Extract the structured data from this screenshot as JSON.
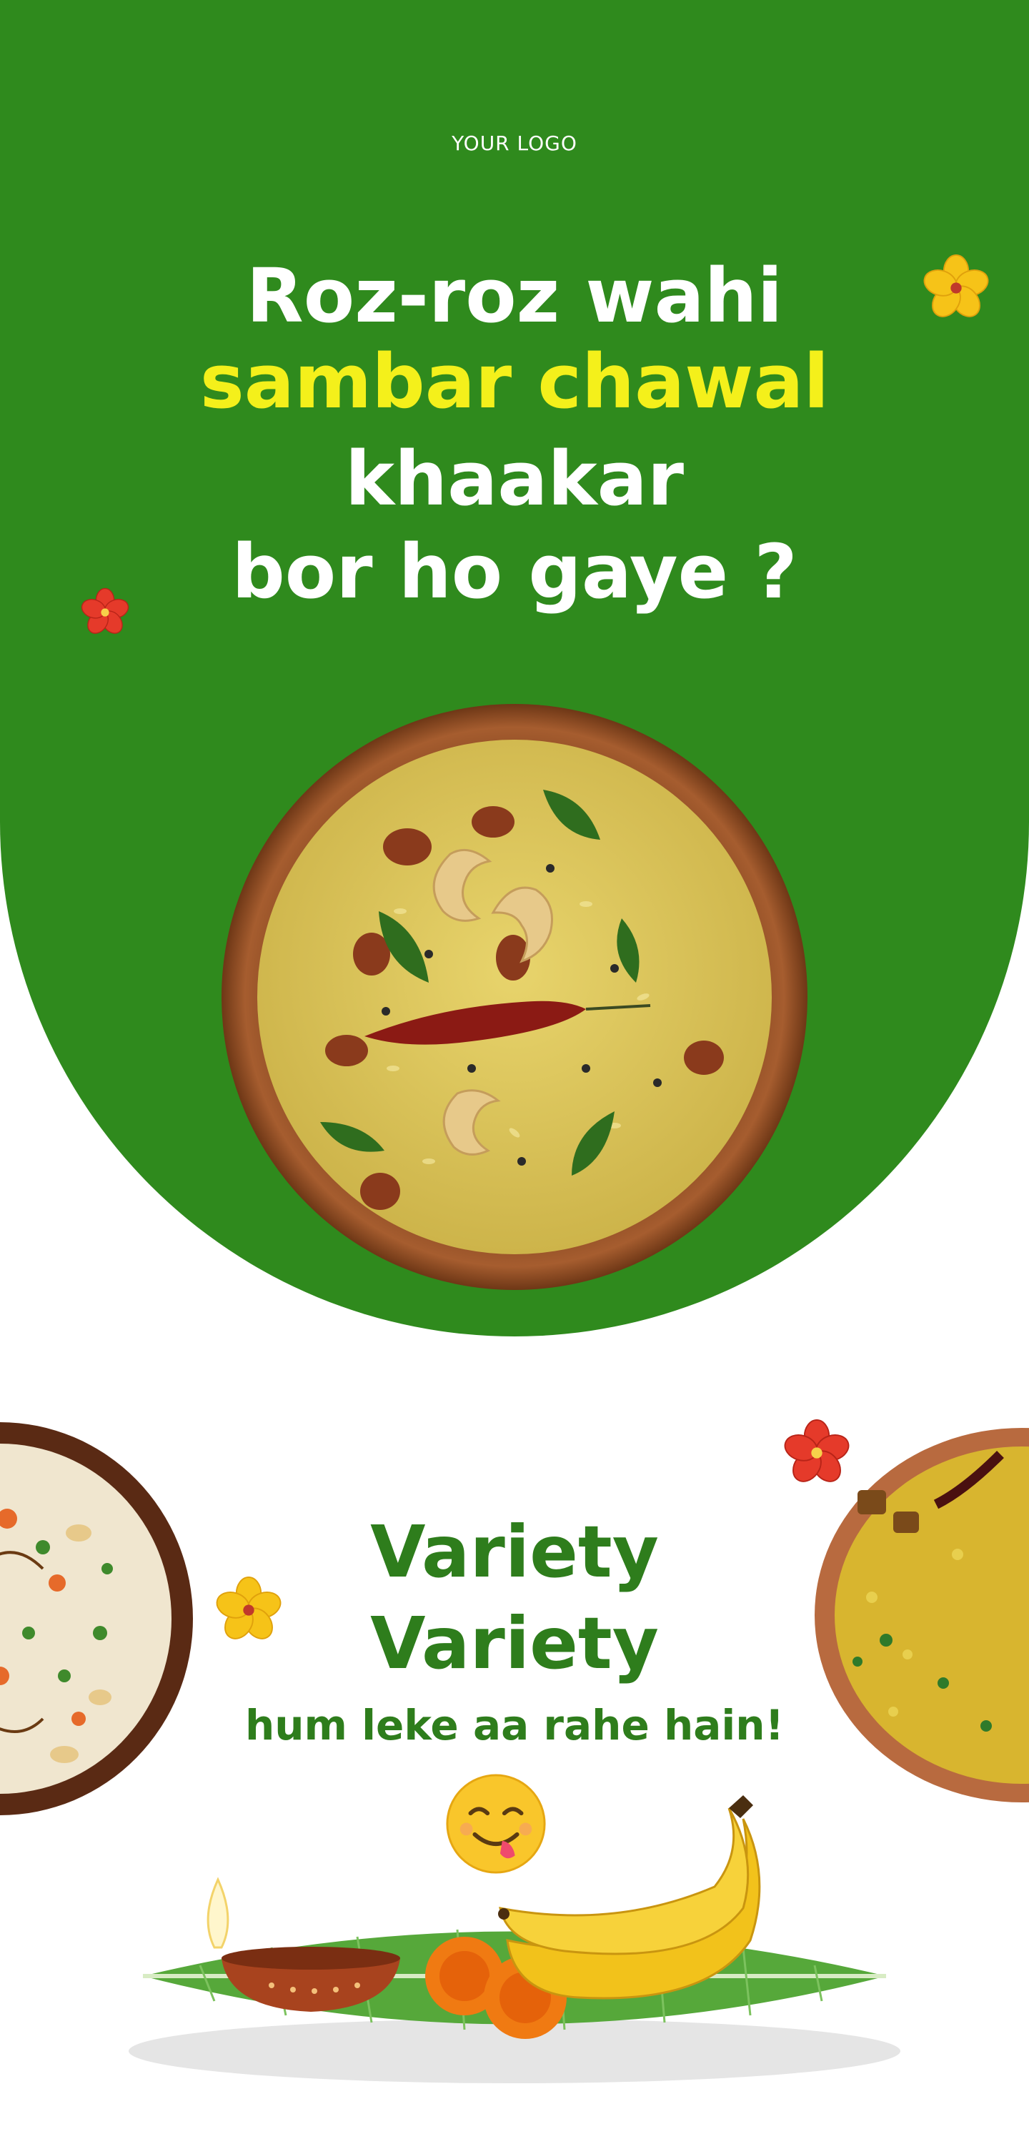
{
  "logo": {
    "text": "YOUR LOGO"
  },
  "headline": {
    "line1": "Roz-roz wahi",
    "line2": "sambar chawal",
    "line3": "khaakar",
    "line4": "bor ho gaye ?"
  },
  "promo": {
    "line1": "Variety",
    "line2": "Variety",
    "line3": "hum leke aa rahe hain!"
  },
  "icons": {
    "emoji": "yum-face-icon",
    "flowers": [
      "hibiscus-yellow-icon",
      "hibiscus-red-icon",
      "hibiscus-yellow-icon",
      "hibiscus-red-icon"
    ],
    "bowls": [
      "lemon-rice-bowl",
      "biryani-bowl",
      "yellow-rice-bowl"
    ],
    "offerings": [
      "diya-icon",
      "marigold-icon",
      "banana-icon",
      "banana-leaf-icon"
    ]
  },
  "colors": {
    "brand_green": "#2f8a1d",
    "highlight_yellow": "#f4f01b",
    "promo_green": "#2e7d1c",
    "background": "#ffffff"
  }
}
